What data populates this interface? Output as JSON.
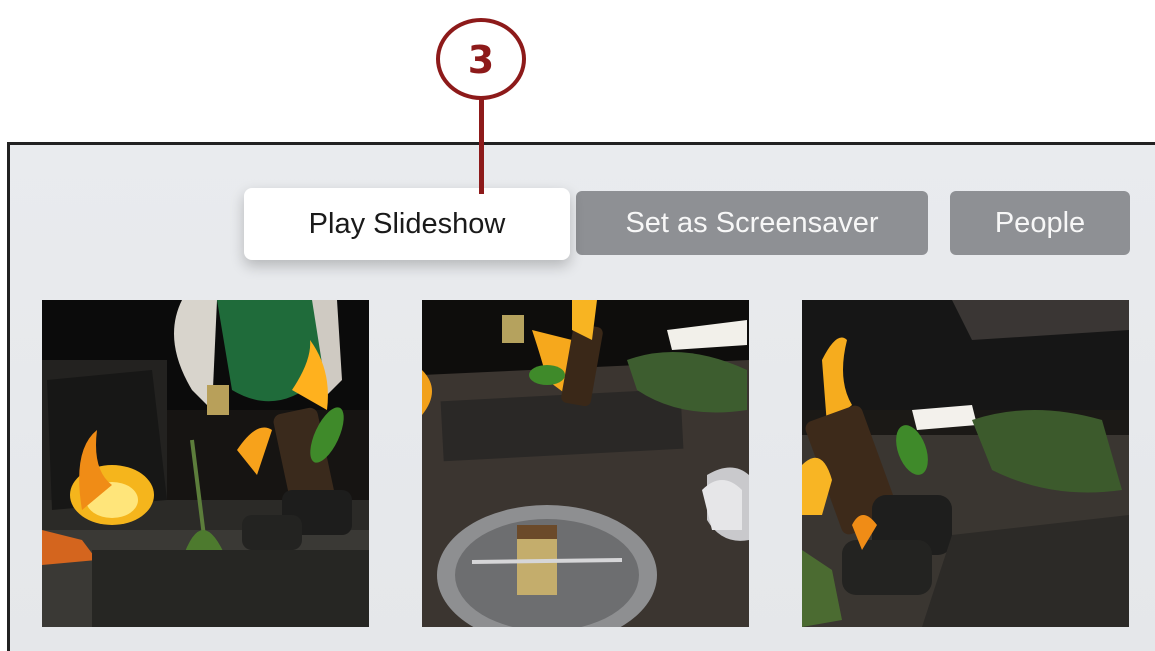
{
  "callout": {
    "number": "3"
  },
  "toolbar": {
    "play_slideshow": "Play Slideshow",
    "set_as_screensaver": "Set as Screensaver",
    "people": "People"
  },
  "photos": [
    {
      "subject": "fire-dish-photo"
    },
    {
      "subject": "fire-dish-photo"
    },
    {
      "subject": "fire-dish-photo"
    }
  ],
  "colors": {
    "callout": "#8d1a1a",
    "focused_button_bg": "#ffffff",
    "secondary_button_bg": "#8e9094",
    "screen_bg": "#e8eaed"
  }
}
